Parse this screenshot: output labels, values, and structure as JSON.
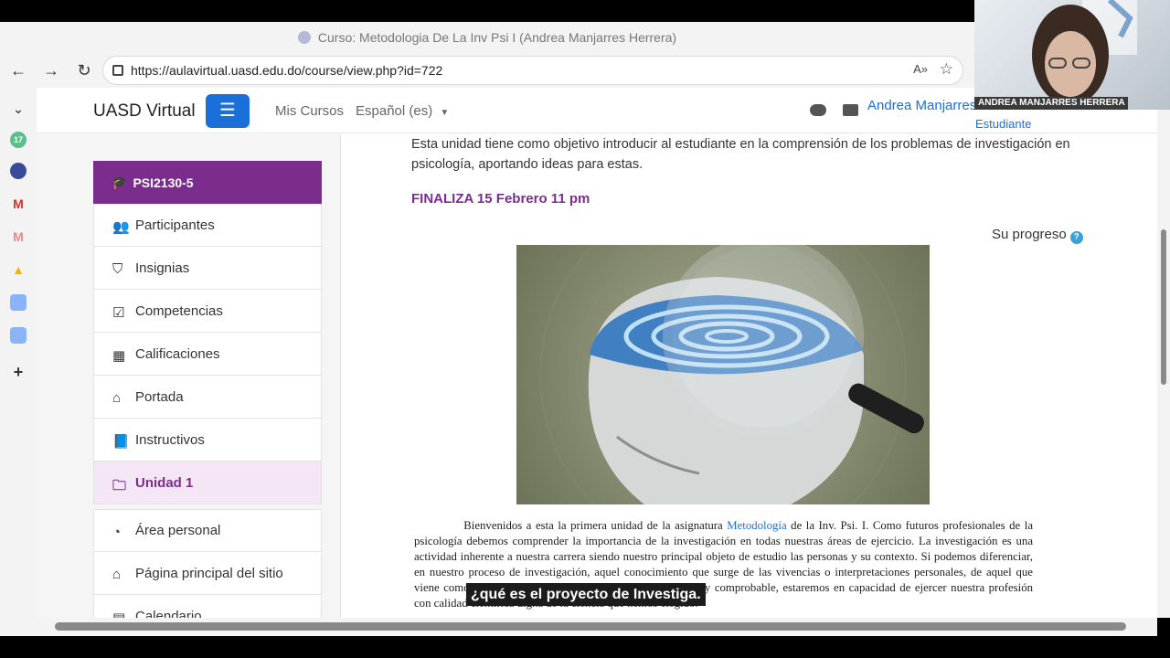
{
  "browser": {
    "tab_title": "Curso: Metodologia De La Inv Psi I (Andrea Manjarres Herrera)",
    "url": "https://aulavirtual.uasd.edu.do/course/view.php?id=722"
  },
  "edge_sidebar": {
    "badge_count": "17"
  },
  "topnav": {
    "brand": "UASD Virtual",
    "links": [
      "Mis Cursos",
      "Español (es)"
    ],
    "user_name": "Andrea Manjarres"
  },
  "course_menu": {
    "header": "PSI2130-5",
    "items": [
      {
        "label": "Participantes",
        "icon": "users-icon"
      },
      {
        "label": "Insignias",
        "icon": "shield-icon"
      },
      {
        "label": "Competencias",
        "icon": "checkbox-icon"
      },
      {
        "label": "Calificaciones",
        "icon": "table-icon"
      },
      {
        "label": "Portada",
        "icon": "home-icon"
      },
      {
        "label": "Instructivos",
        "icon": "book-icon"
      },
      {
        "label": "Unidad 1",
        "icon": "folder-icon",
        "active": true
      }
    ],
    "secondary_items": [
      {
        "label": "Área personal",
        "icon": "dashboard-icon"
      },
      {
        "label": "Página principal del sitio",
        "icon": "home-icon"
      },
      {
        "label": "Calendario",
        "icon": "calendar-icon"
      }
    ]
  },
  "main": {
    "intro": "Esta unidad tiene como objetivo introducir al estudiante en la comprensión de los problemas de investigación en psicología, aportando ideas para estas.",
    "deadline": "FINALIZA 15 Febrero 11 pm",
    "progress_label": "Su progreso",
    "progress_help": "?",
    "body_start": "Bienvenidos a esta la primera unidad de la asignatura ",
    "body_link": "Metodología",
    "body_rest": " de la Inv. Psi. I. Como futuros profesionales de la psicología debemos comprender la importancia de la investigación en todas nuestras áreas de ejercicio. La investigación es una actividad inherente a nuestra carrera siendo nuestro principal objeto de estudio las personas y su contexto. Si podemos diferenciar, en nuestro proceso de investigación, aquel conocimiento que surge de las vivencias o interpretaciones personales, de aquel que viene como resultado de una búsqueda sistemática, dirigida y comprobable, estaremos en capacidad de ejercer nuestra profesión con calidad científica digna de la ciencia que hemos elegido."
  },
  "webcam": {
    "name_tag": "ANDREA MANJARRES HERRERA",
    "role": "Estudiante"
  },
  "caption": "¿qué es el proyecto de Investiga.",
  "colors": {
    "brand_purple": "#7b2d8e",
    "primary_blue": "#1b6fd8",
    "active_bg": "#f5e6f5"
  }
}
